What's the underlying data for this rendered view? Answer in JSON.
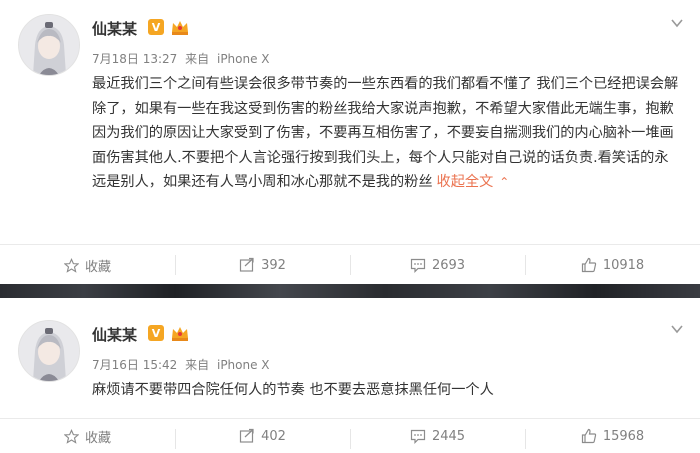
{
  "posts": [
    {
      "author": "仙某某",
      "badge_v": "V",
      "meta": {
        "date": "7月18日 13:27",
        "source_prefix": "来自",
        "source": "iPhone X"
      },
      "text": "最近我们三个之间有些误会很多带节奏的一些东西看的我们都看不懂了 我们三个已经把误会解除了，如果有一些在我这受到伤害的粉丝我给大家说声抱歉，不希望大家借此无端生事，抱歉因为我们的原因让大家受到了伤害，不要再互相伤害了，不要妄自揣测我们的内心脑补一堆画面伤害其他人.不要把个人言论强行按到我们头上，每个人只能对自己说的话负责.看笑话的永远是别人，如果还有人骂小周和冰心那就不是我的粉丝",
      "collapse_label": "收起全文",
      "actions": {
        "favorite": "收藏",
        "repost": "392",
        "comment": "2693",
        "like": "10918"
      }
    },
    {
      "author": "仙某某",
      "badge_v": "V",
      "meta": {
        "date": "7月16日 15:42",
        "source_prefix": "来自",
        "source": "iPhone X"
      },
      "text": "麻烦请不要带四合院任何人的节奏 也不要去恶意抹黑任何一个人",
      "actions": {
        "favorite": "收藏",
        "repost": "402",
        "comment": "2445",
        "like": "15968"
      }
    }
  ],
  "colors": {
    "accent": "#eb7350",
    "badge": "#f5a623",
    "text": "#333333",
    "muted": "#808080"
  }
}
